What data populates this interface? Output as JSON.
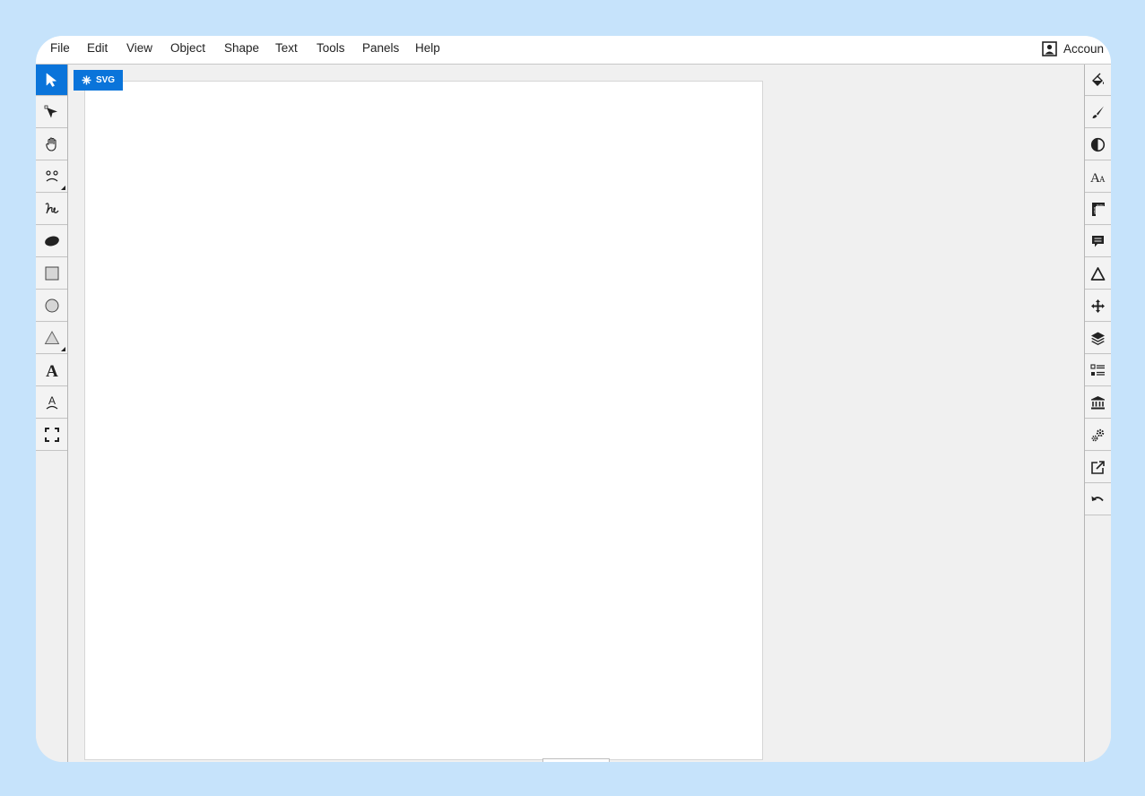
{
  "menu": {
    "items": [
      {
        "label": "File"
      },
      {
        "label": "Edit"
      },
      {
        "label": "View"
      },
      {
        "label": "Object"
      },
      {
        "label": "Shape"
      },
      {
        "label": "Text"
      },
      {
        "label": "Tools"
      },
      {
        "label": "Panels"
      },
      {
        "label": "Help"
      }
    ],
    "account_label": "Accoun"
  },
  "left_tools": [
    {
      "icon": "select-arrow-icon",
      "active": true
    },
    {
      "icon": "node-edit-icon"
    },
    {
      "icon": "hand-pan-icon"
    },
    {
      "icon": "symbol-face-icon"
    },
    {
      "icon": "freehand-pen-icon"
    },
    {
      "icon": "ellipse-fill-icon"
    },
    {
      "icon": "rectangle-icon"
    },
    {
      "icon": "circle-icon"
    },
    {
      "icon": "triangle-icon"
    },
    {
      "icon": "text-icon"
    },
    {
      "icon": "text-path-icon"
    },
    {
      "icon": "fullscreen-icon"
    }
  ],
  "right_tools": [
    {
      "icon": "fill-bucket-icon"
    },
    {
      "icon": "brush-icon"
    },
    {
      "icon": "contrast-icon"
    },
    {
      "icon": "font-size-icon"
    },
    {
      "icon": "ruler-icon"
    },
    {
      "icon": "comment-icon"
    },
    {
      "icon": "triangle-outline-icon"
    },
    {
      "icon": "move-icon"
    },
    {
      "icon": "layers-icon"
    },
    {
      "icon": "list-icon"
    },
    {
      "icon": "library-icon"
    },
    {
      "icon": "settings-gears-icon"
    },
    {
      "icon": "export-icon"
    },
    {
      "icon": "undo-icon"
    }
  ],
  "canvas": {
    "svg_tag_label": "SVG"
  },
  "colors": {
    "accent": "#0a74da",
    "background": "#c6e3fb",
    "workspace": "#f0f0f0"
  }
}
